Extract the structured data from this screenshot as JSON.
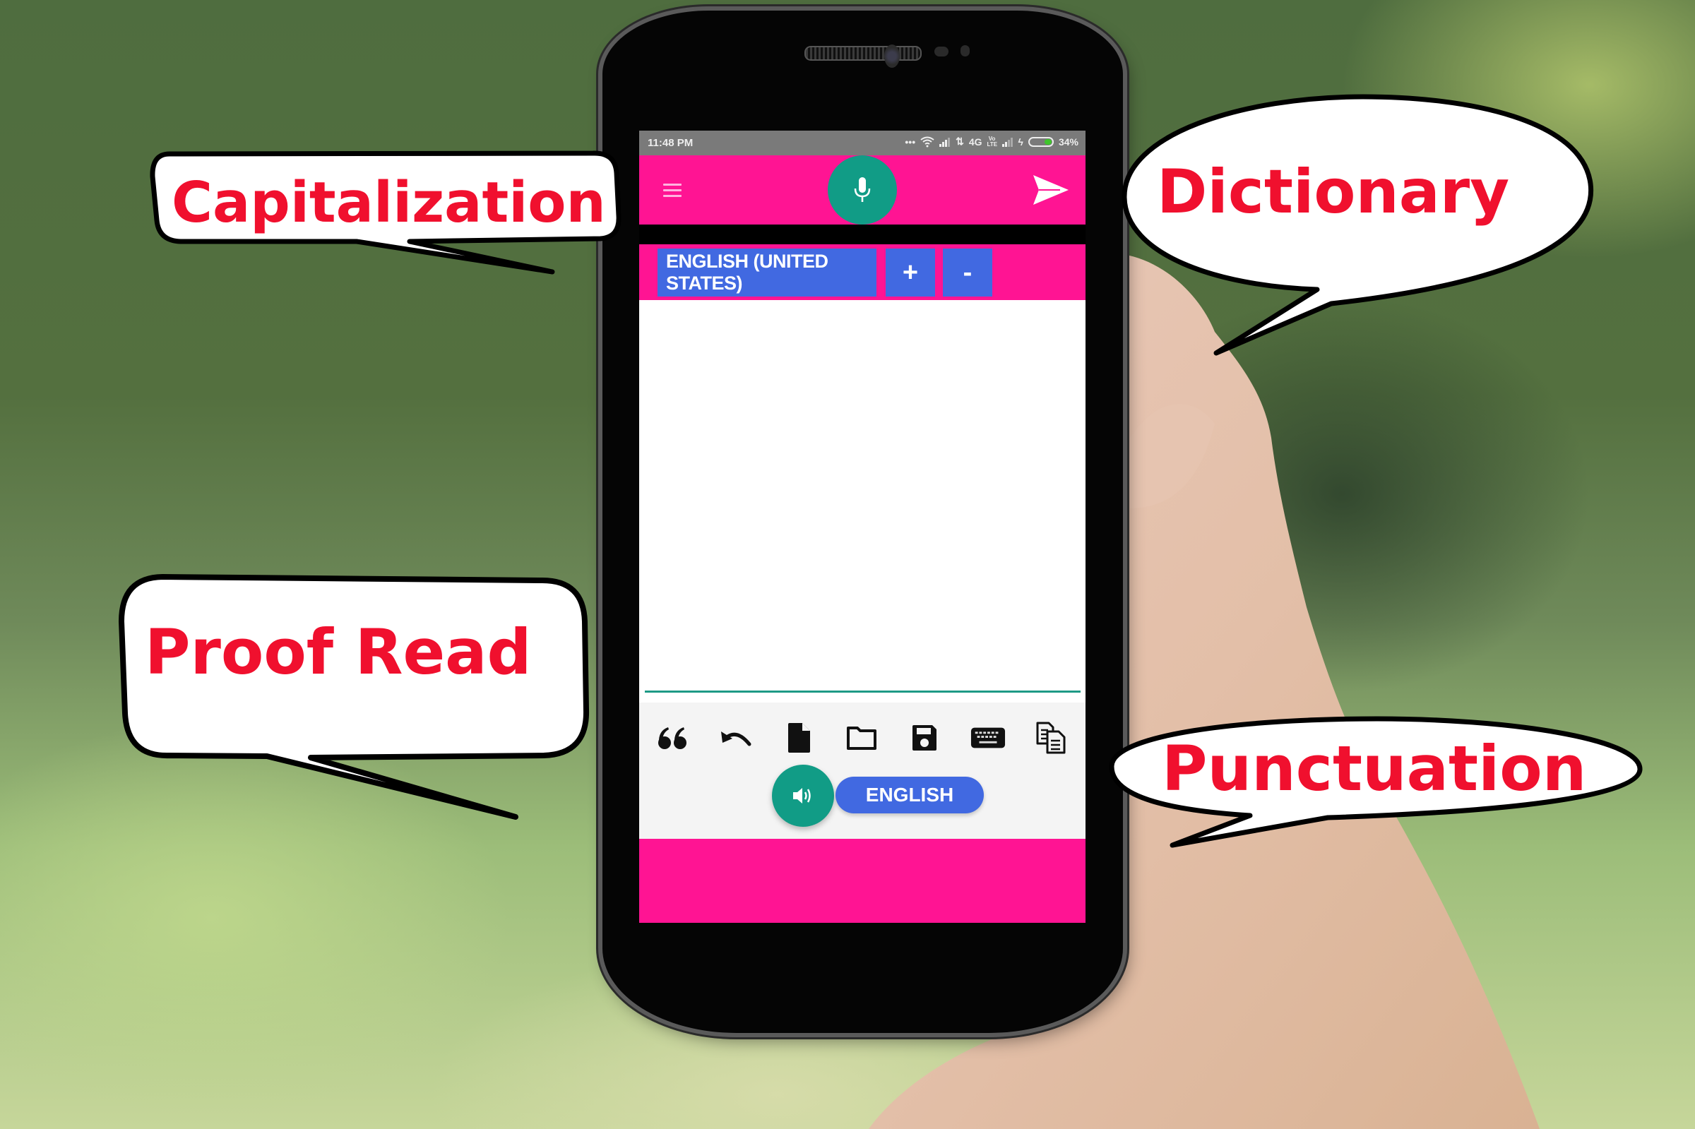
{
  "status_bar": {
    "time": "11:48 PM",
    "network_type": "4G",
    "volte_label": "Vo LTE",
    "battery_percent_label": "34%",
    "battery_level": 0.34
  },
  "app_bar": {
    "menu_icon": "hamburger-menu-icon",
    "mic_icon": "microphone-icon",
    "send_icon": "send-icon"
  },
  "language_row": {
    "selected_language": "ENGLISH (UNITED STATES)",
    "add_label": "+",
    "remove_label": "-"
  },
  "editor": {
    "text": ""
  },
  "toolbar": {
    "tools": [
      {
        "name": "quote",
        "icon": "quote-icon"
      },
      {
        "name": "undo",
        "icon": "undo-icon"
      },
      {
        "name": "new-file",
        "icon": "file-icon"
      },
      {
        "name": "open-folder",
        "icon": "folder-icon"
      },
      {
        "name": "save",
        "icon": "save-icon"
      },
      {
        "name": "keyboard",
        "icon": "keyboard-icon"
      },
      {
        "name": "copy",
        "icon": "copy-icon"
      }
    ],
    "speak_icon": "speaker-icon",
    "language_pill": "ENGLISH"
  },
  "callouts": {
    "capitalization": "Capitalization",
    "dictionary": "Dictionary",
    "proof_read": "Proof Read",
    "punctuation": "Punctuation"
  },
  "colors": {
    "primary_pink": "#ff1493",
    "teal": "#119c86",
    "royal_blue": "#4169e1",
    "callout_text": "#f0102e",
    "status_gray": "#7a7a7a"
  }
}
